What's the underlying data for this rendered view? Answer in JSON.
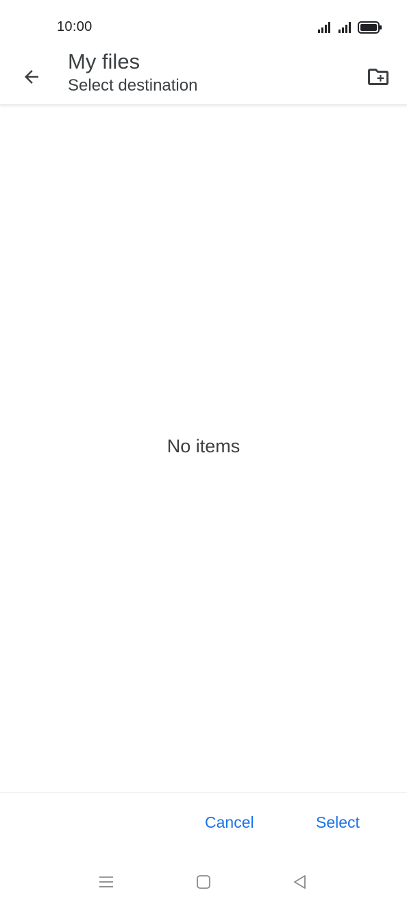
{
  "status_bar": {
    "time": "10:00",
    "icons": [
      "signal-icon",
      "signal-icon",
      "battery-icon"
    ]
  },
  "app_bar": {
    "title": "My files",
    "subtitle": "Select destination",
    "back_icon": "arrow-back-icon",
    "new_folder_icon": "create-new-folder-icon"
  },
  "content": {
    "empty_message": "No items"
  },
  "actions": {
    "cancel_label": "Cancel",
    "select_label": "Select"
  },
  "nav_bar": {
    "icons": [
      "menu-icon",
      "home-square-icon",
      "back-triangle-icon"
    ]
  },
  "colors": {
    "accent": "#1a73e8",
    "text": "#3c4043",
    "background": "#ffffff"
  }
}
